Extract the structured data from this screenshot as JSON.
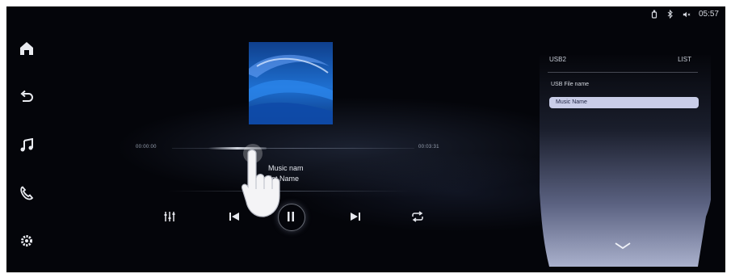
{
  "status": {
    "time": "05:57",
    "icons": [
      "usb-icon",
      "bluetooth-icon",
      "volume-mute-icon"
    ]
  },
  "sidebar": {
    "items": [
      {
        "name": "home-icon"
      },
      {
        "name": "back-icon"
      },
      {
        "name": "music-icon"
      },
      {
        "name": "phone-icon"
      },
      {
        "name": "settings-icon"
      }
    ]
  },
  "player": {
    "elapsed": "00:00:00",
    "total": "00:03:31",
    "progress": 0.35,
    "song_title": "Music nam",
    "artist": "tist Name",
    "controls": [
      "equalizer-icon",
      "previous-icon",
      "pause-icon",
      "next-icon",
      "repeat-icon"
    ]
  },
  "playlist": {
    "source_tab": "USB2",
    "list_tab": "LIST",
    "folder": "USB File name",
    "selected_track": "Music Name"
  },
  "colors": {
    "accent": "#c9cde8",
    "background": "#04050a"
  }
}
